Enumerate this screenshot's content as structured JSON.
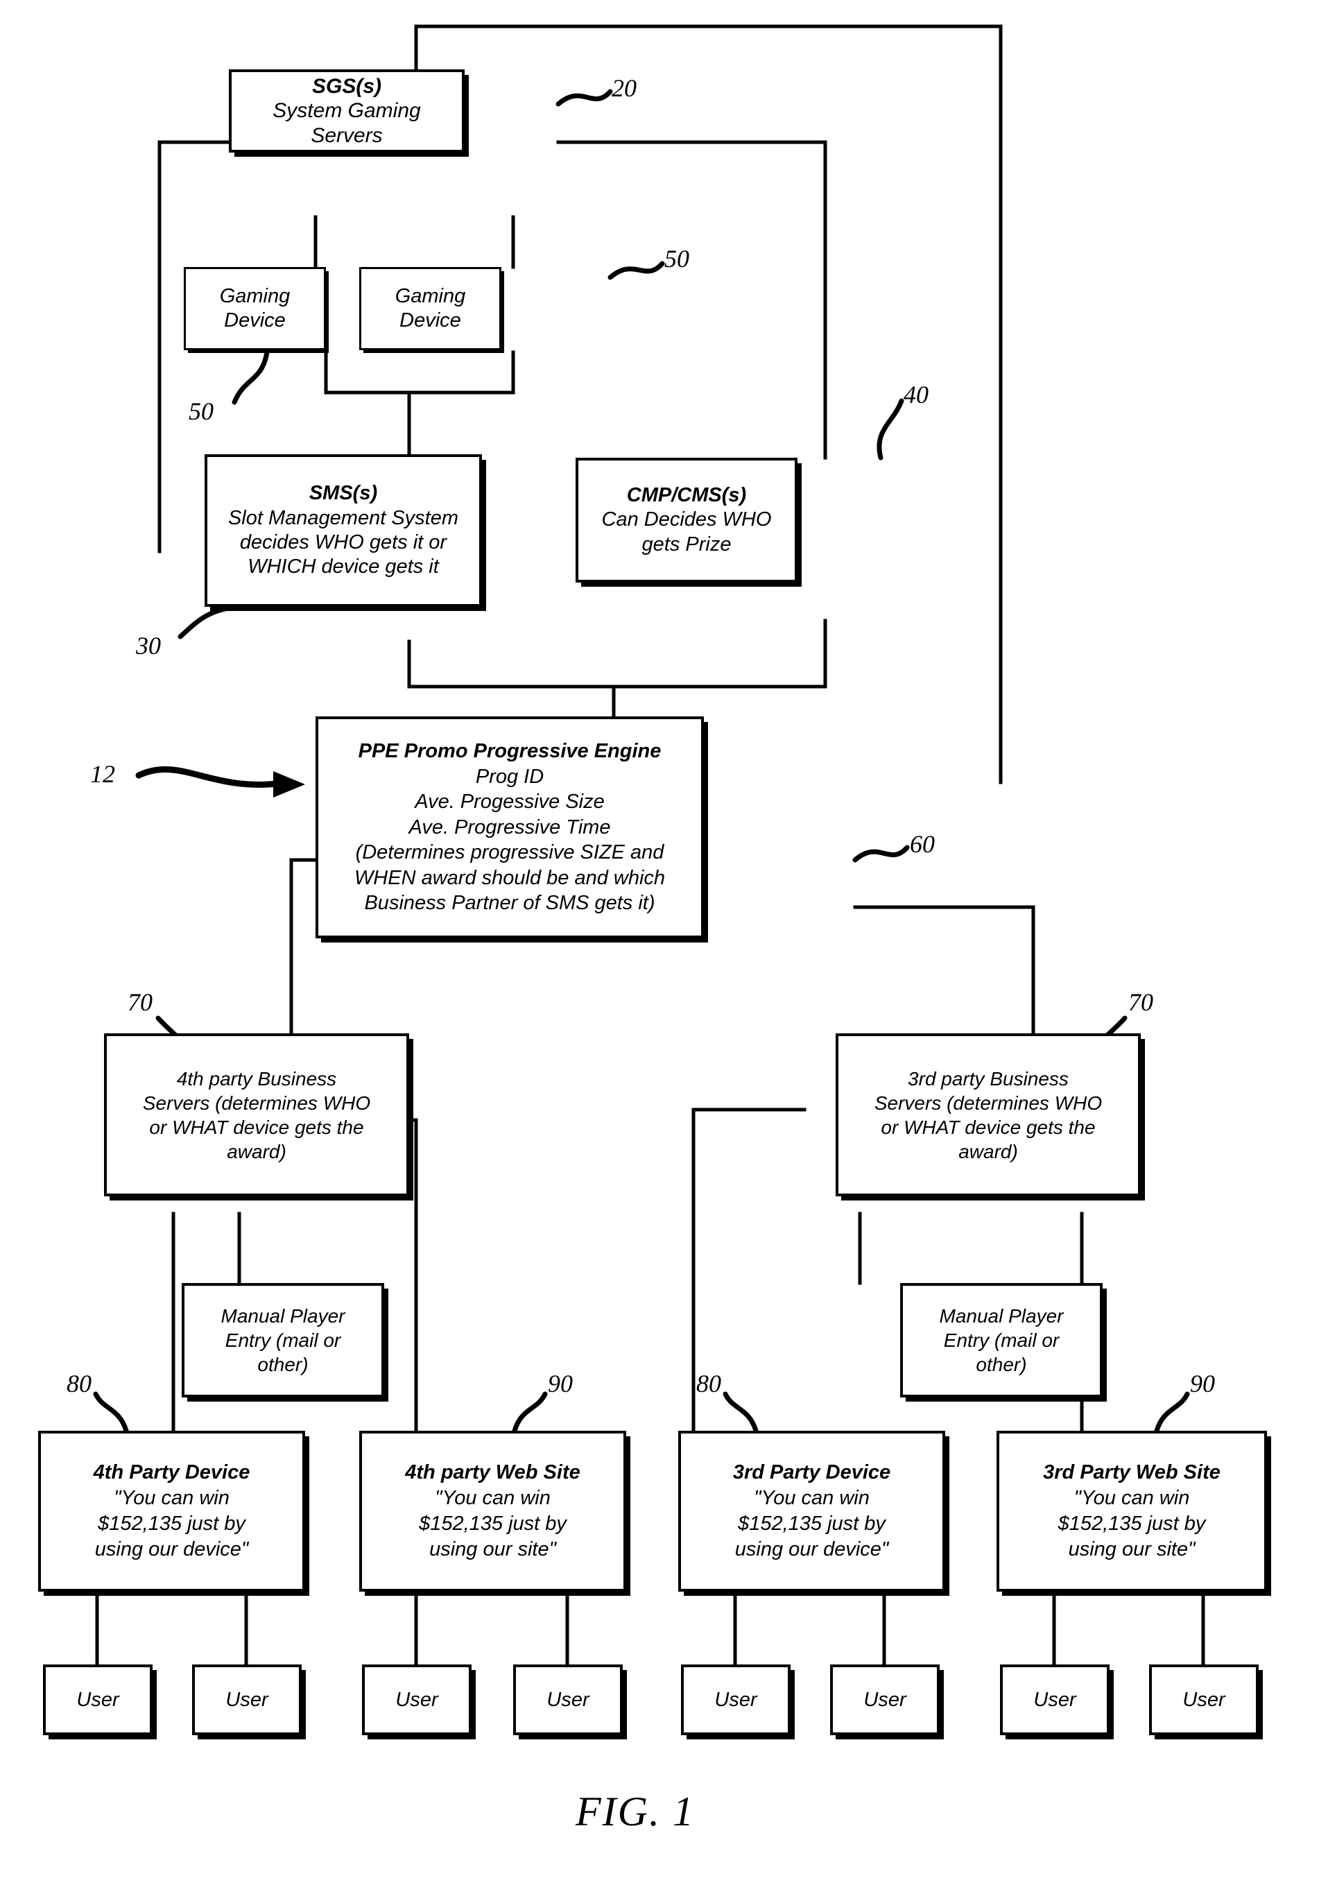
{
  "figure": {
    "caption": "FIG. 1"
  },
  "boxes": {
    "sgs": {
      "title": "SGS(s)",
      "lines": [
        "System Gaming",
        "Servers"
      ]
    },
    "gaming_device_left": {
      "lines": [
        "Gaming",
        "Device"
      ]
    },
    "gaming_device_right": {
      "lines": [
        "Gaming",
        "Device"
      ]
    },
    "sms": {
      "title": "SMS(s)",
      "lines": [
        "Slot Management System",
        "decides WHO gets it or",
        "WHICH device gets it"
      ]
    },
    "cmp_cms": {
      "title": "CMP/CMS(s)",
      "lines": [
        "Can Decides WHO",
        "gets Prize"
      ]
    },
    "ppe": {
      "title": "PPE Promo Progressive Engine",
      "lines": [
        "Prog ID",
        "Ave. Progessive Size",
        "Ave. Progressive Time",
        "(Determines progressive SIZE and",
        "WHEN award should be and which",
        "Business Partner of SMS gets it)"
      ]
    },
    "business_servers_4th": {
      "lines": [
        "4th party Business",
        "Servers (determines WHO",
        "or WHAT device gets the",
        "award)"
      ]
    },
    "business_servers_3rd": {
      "lines": [
        "3rd party Business",
        "Servers (determines WHO",
        "or WHAT device gets the",
        "award)"
      ]
    },
    "manual_entry_left": {
      "lines": [
        "Manual Player",
        "Entry (mail or",
        "other)"
      ]
    },
    "manual_entry_right": {
      "lines": [
        "Manual Player",
        "Entry (mail or",
        "other)"
      ]
    },
    "device_4th": {
      "title": "4th Party Device",
      "lines": [
        "\"You can win",
        "$152,135 just by",
        "using our device\""
      ]
    },
    "website_4th": {
      "title": "4th party Web Site",
      "lines": [
        "\"You can win",
        "$152,135 just by",
        "using our site\""
      ]
    },
    "device_3rd": {
      "title": "3rd Party Device",
      "lines": [
        "\"You can win",
        "$152,135 just by",
        "using our device\""
      ]
    },
    "website_3rd": {
      "title": "3rd Party Web Site",
      "lines": [
        "\"You can win",
        "$152,135 just by",
        "using our site\""
      ]
    },
    "user_1": {
      "label": "User"
    },
    "user_2": {
      "label": "User"
    },
    "user_3": {
      "label": "User"
    },
    "user_4": {
      "label": "User"
    },
    "user_5": {
      "label": "User"
    },
    "user_6": {
      "label": "User"
    },
    "user_7": {
      "label": "User"
    },
    "user_8": {
      "label": "User"
    }
  },
  "reference_numerals": {
    "sgs": "20",
    "gaming_device_right": "50",
    "gaming_device_left": "50",
    "cmp_cms": "40",
    "sms": "30",
    "system": "12",
    "ppe": "60",
    "business_servers_4th": "70",
    "business_servers_3rd": "70",
    "device_4th": "80",
    "website_4th": "90",
    "device_3rd": "80",
    "website_3rd": "90"
  },
  "colors": {
    "ink": "#000000",
    "paper": "#ffffff"
  }
}
